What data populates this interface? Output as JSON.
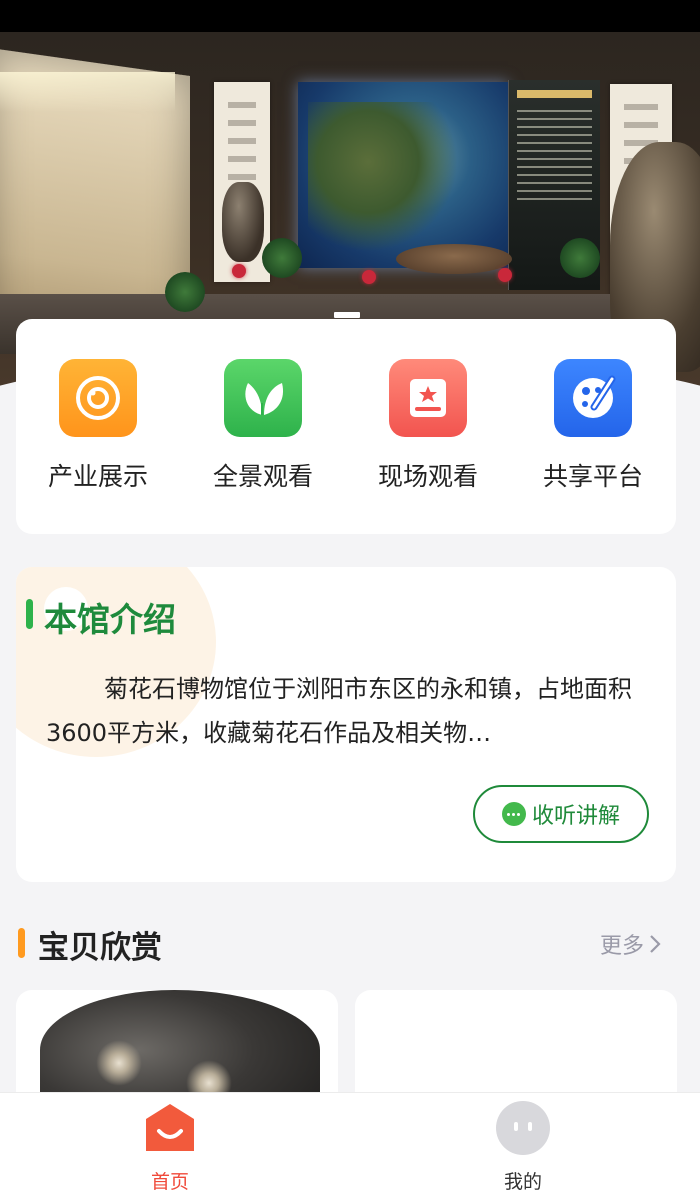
{
  "hero": {
    "image_alt": "museum exhibition hall",
    "carousel_active_index": 0
  },
  "quick_nav": {
    "items": [
      {
        "label": "产业展示",
        "icon": "camera-lens-icon",
        "color": "#ff9f26"
      },
      {
        "label": "全景观看",
        "icon": "leaf-icon",
        "color": "#3cc457"
      },
      {
        "label": "现场观看",
        "icon": "book-star-icon",
        "color": "#f6625b"
      },
      {
        "label": "共享平台",
        "icon": "palette-icon",
        "color": "#2f74f5"
      }
    ]
  },
  "intro": {
    "title": "本馆介绍",
    "text": "菊花石博物馆位于浏阳市东区的永和镇，占地面积3600平方米，收藏菊花石作品及相关物…",
    "listen_label": "收听讲解"
  },
  "gallery": {
    "title": "宝贝欣赏",
    "more_label": "更多"
  },
  "tabbar": {
    "tabs": [
      {
        "label": "首页",
        "icon": "home-icon",
        "active": true
      },
      {
        "label": "我的",
        "icon": "profile-icon",
        "active": false
      }
    ]
  },
  "colors": {
    "accent_green": "#1e8a3c",
    "accent_orange": "#ff9a1f",
    "active_tab": "#f04a3a"
  }
}
